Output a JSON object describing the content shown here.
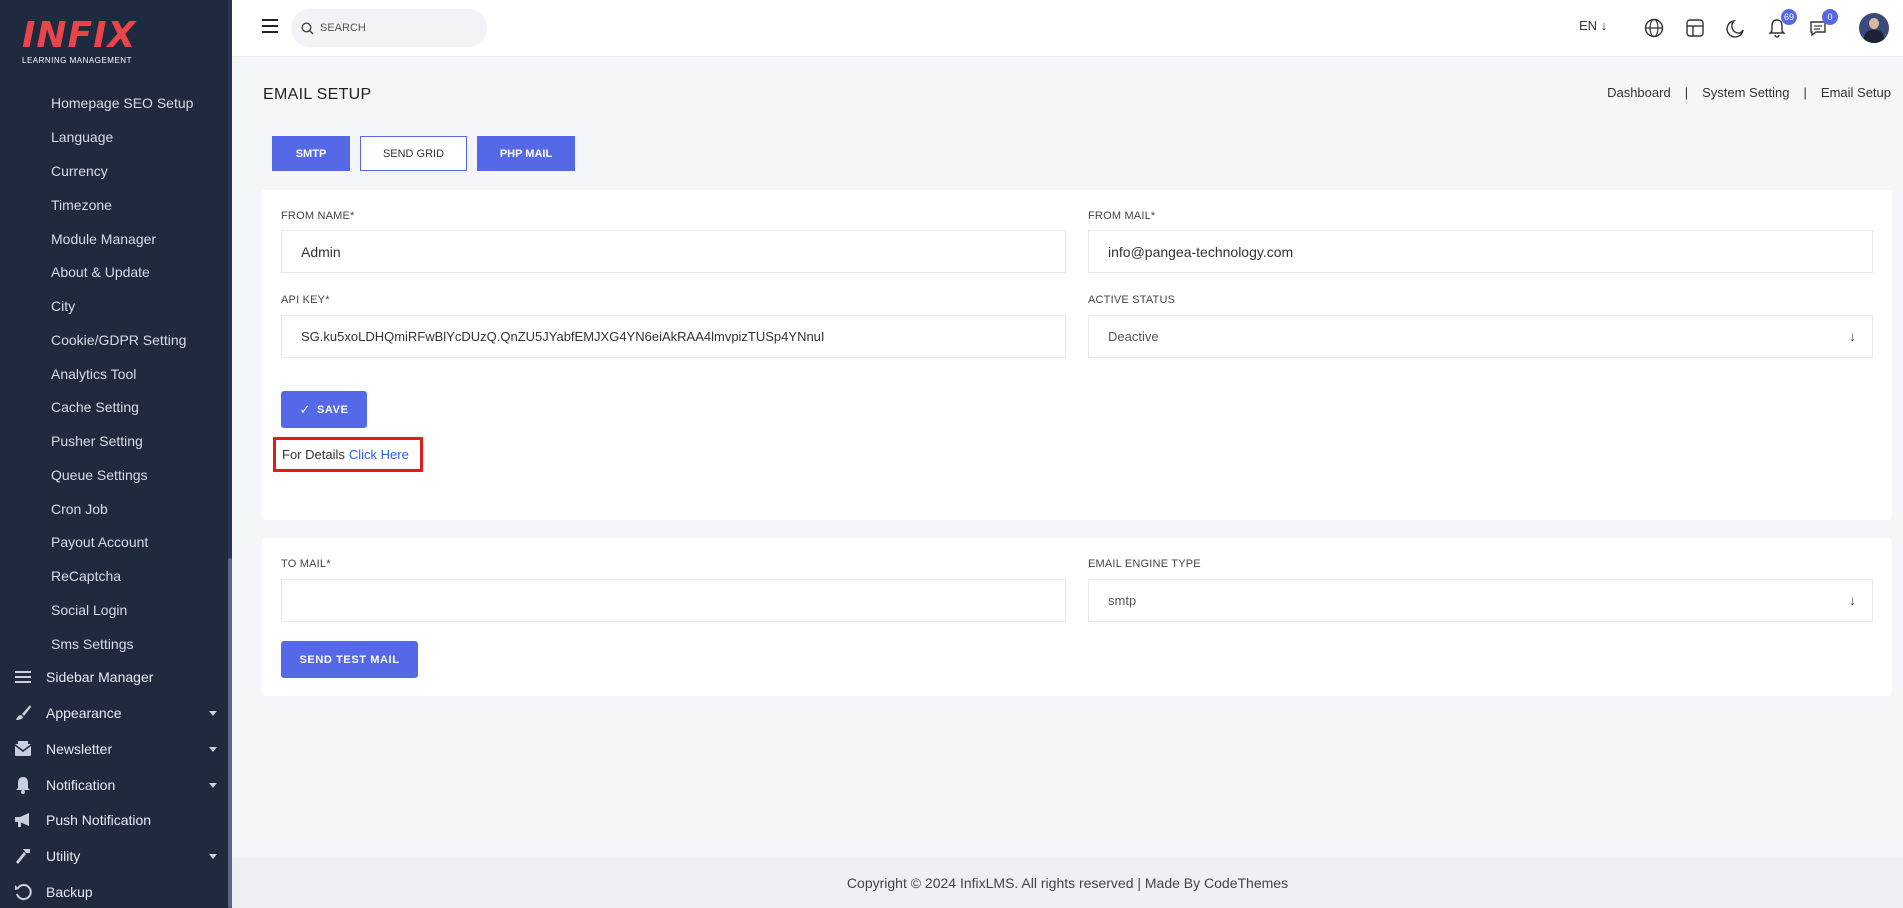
{
  "brand": {
    "logo_text": "INFIX",
    "tagline": "LEARNING MANAGEMENT"
  },
  "sidebar": {
    "sub_items": [
      "Homepage SEO Setup",
      "Language",
      "Currency",
      "Timezone",
      "Module Manager",
      "About & Update",
      "City",
      "Cookie/GDPR Setting",
      "Analytics Tool",
      "Cache Setting",
      "Pusher Setting",
      "Queue Settings",
      "Cron Job",
      "Payout Account",
      "ReCaptcha",
      "Social Login",
      "Sms Settings"
    ],
    "main_items": [
      {
        "label": "Sidebar Manager",
        "icon": "list-icon"
      },
      {
        "label": "Appearance",
        "icon": "brush-icon"
      },
      {
        "label": "Newsletter",
        "icon": "newsletter-icon"
      },
      {
        "label": "Notification",
        "icon": "bell-icon"
      },
      {
        "label": "Push Notification",
        "icon": "megaphone-icon"
      },
      {
        "label": "Utility",
        "icon": "hammer-icon"
      },
      {
        "label": "Backup",
        "icon": "backup-icon"
      }
    ]
  },
  "topbar": {
    "search_placeholder": "SEARCH",
    "language": "EN",
    "notifications_count": "69",
    "messages_count": "0"
  },
  "page": {
    "title": "EMAIL SETUP",
    "breadcrumb": [
      "Dashboard",
      "|",
      "System Setting",
      "|",
      "Email Setup"
    ]
  },
  "tabs": [
    "SMTP",
    "SEND GRID",
    "PHP MAIL"
  ],
  "form": {
    "from_name_label": "FROM NAME*",
    "from_name_value": "Admin",
    "from_mail_label": "FROM MAIL*",
    "from_mail_value": "info@pangea-technology.com",
    "api_key_label": "API KEY*",
    "api_key_value": "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",
    "active_status_label": "ACTIVE STATUS",
    "active_status_value": "Deactive",
    "save_label": "SAVE",
    "details_text": "For Details",
    "details_link": "Click Here"
  },
  "test_mail": {
    "to_mail_label": "TO MAIL*",
    "to_mail_value": "",
    "engine_label": "EMAIL ENGINE TYPE",
    "engine_value": "smtp",
    "send_label": "SEND TEST MAIL"
  },
  "footer": {
    "text": "Copyright © 2024 InfixLMS. All rights reserved | Made By CodeThemes"
  },
  "colors": {
    "accent": "#5569e8",
    "sidebar_bg": "#202a3f",
    "highlight_border": "#e21b1b"
  }
}
